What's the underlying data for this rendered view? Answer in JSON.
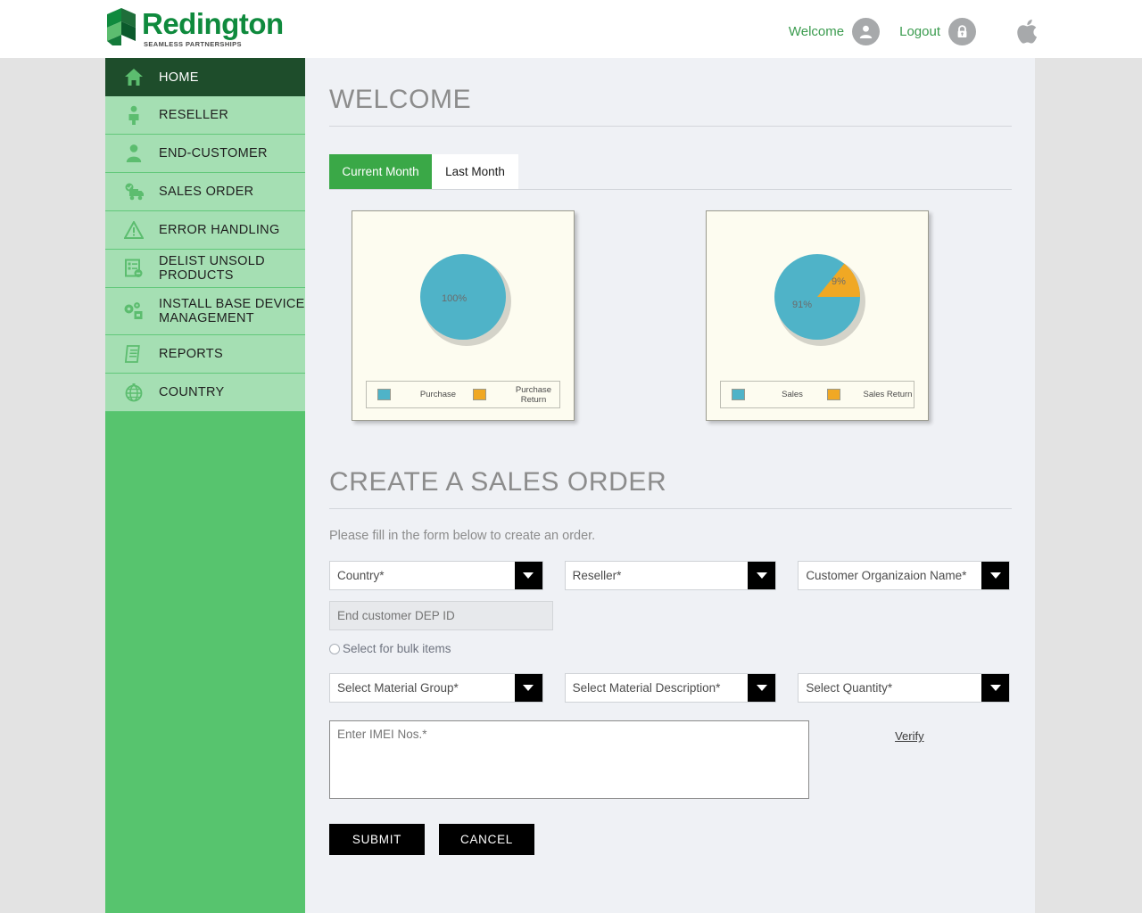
{
  "header": {
    "logo_word": "Redington",
    "logo_tagline": "SEAMLESS PARTNERSHIPS",
    "logo_icon": "redington-logo-mark",
    "welcome_label": "Welcome",
    "welcome_icon": "user-avatar-icon",
    "logout_label": "Logout",
    "logout_icon": "lock-icon",
    "brand_icon": "apple-icon"
  },
  "sidebar": {
    "items": [
      {
        "label": "HOME",
        "icon": "home-icon",
        "active": true
      },
      {
        "label": "RESELLER",
        "icon": "reseller-person-icon",
        "active": false
      },
      {
        "label": "END-CUSTOMER",
        "icon": "person-icon",
        "active": false
      },
      {
        "label": "SALES ORDER",
        "icon": "delivery-truck-icon",
        "active": false
      },
      {
        "label": "ERROR HANDLING",
        "icon": "warning-triangle-icon",
        "active": false
      },
      {
        "label": "DELIST UNSOLD PRODUCTS",
        "icon": "list-remove-icon",
        "active": false
      },
      {
        "label": "INSTALL BASE DEVICE MANAGEMENT",
        "icon": "gear-device-icon",
        "active": false
      },
      {
        "label": "REPORTS",
        "icon": "report-document-icon",
        "active": false
      },
      {
        "label": "COUNTRY",
        "icon": "globe-icon",
        "active": false
      }
    ]
  },
  "main": {
    "page_title": "WELCOME",
    "tabs": [
      {
        "label": "Current Month",
        "active": true
      },
      {
        "label": "Last Month",
        "active": false
      }
    ]
  },
  "chart_data": [
    {
      "type": "pie",
      "title": "",
      "categories": [
        "Purchase",
        "Purchase Return"
      ],
      "values": [
        100,
        0
      ],
      "labels": [
        "100%",
        ""
      ],
      "colors": [
        "#4fb3c8",
        "#f0a824"
      ],
      "legend": [
        {
          "label": "Purchase",
          "color": "#4fb3c8"
        },
        {
          "label": "Purchase Return",
          "color": "#f0a824"
        }
      ],
      "legend_position": "bottom"
    },
    {
      "type": "pie",
      "title": "",
      "categories": [
        "Sales",
        "Sales Return"
      ],
      "values": [
        91,
        9
      ],
      "labels": [
        "91%",
        "9%"
      ],
      "colors": [
        "#4fb3c8",
        "#f0a824"
      ],
      "legend": [
        {
          "label": "Sales",
          "color": "#4fb3c8"
        },
        {
          "label": "Sales Return",
          "color": "#f0a824"
        }
      ],
      "legend_position": "bottom"
    }
  ],
  "form": {
    "title": "CREATE A SALES ORDER",
    "hint": "Please fill in the form below to create an order.",
    "country": {
      "value": "Country*"
    },
    "reseller": {
      "value": "Reseller*"
    },
    "customer_org": {
      "value": "Customer Organizaion Name*"
    },
    "dep_id": {
      "value": "",
      "placeholder": "End customer DEP ID"
    },
    "bulk_radio_label": "Select for bulk items",
    "material_group": {
      "value": "Select Material Group*"
    },
    "material_description": {
      "value": "Select Material Description*"
    },
    "quantity": {
      "value": "Select Quantity*"
    },
    "imei": {
      "value": "",
      "placeholder": "Enter IMEI Nos.*"
    },
    "verify_label": "Verify",
    "submit_label": "SUBMIT",
    "cancel_label": "CANCEL"
  },
  "colors": {
    "brand_green": "#0f8a3d",
    "sidebar_green": "#57c46e",
    "menu_green": "#a5dfb3",
    "active_green": "#1e4d2b",
    "tab_green": "#3aa847",
    "chart_teal": "#4fb3c8",
    "chart_orange": "#f0a824"
  }
}
